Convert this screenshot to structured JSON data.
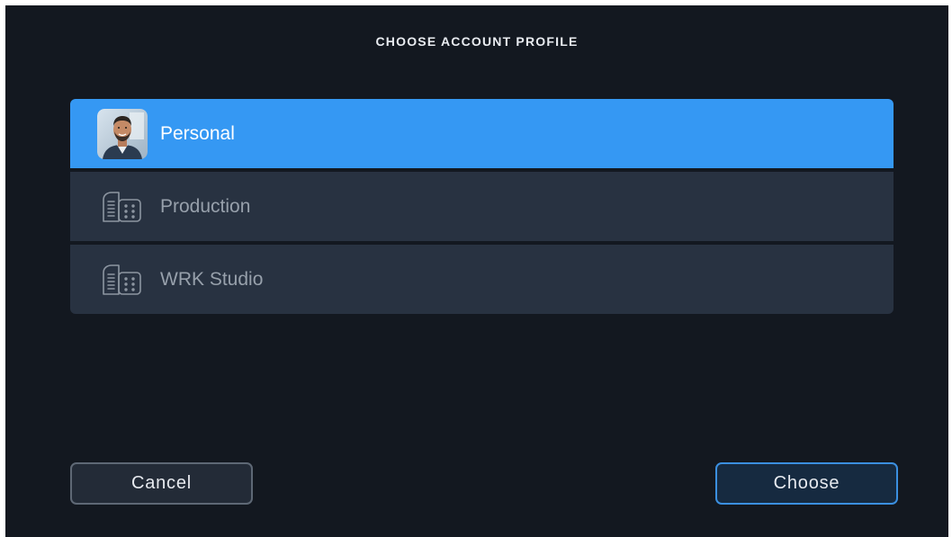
{
  "dialog": {
    "title": "CHOOSE ACCOUNT PROFILE"
  },
  "profiles": [
    {
      "label": "Personal",
      "icon": "user-avatar",
      "selected": true
    },
    {
      "label": "Production",
      "icon": "building-icon",
      "selected": false
    },
    {
      "label": "WRK Studio",
      "icon": "building-icon",
      "selected": false
    }
  ],
  "buttons": {
    "cancel_label": "Cancel",
    "choose_label": "Choose"
  },
  "colors": {
    "background": "#131820",
    "row": "#283241",
    "selected_row": "#3598f3",
    "choose_border": "#3b8fe0"
  }
}
